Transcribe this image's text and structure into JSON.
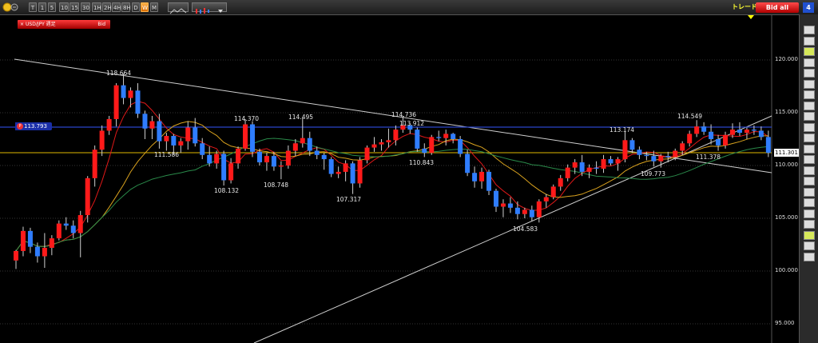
{
  "toolbar": {
    "timeframes": [
      "T",
      "1",
      "5",
      "10",
      "15",
      "30",
      "1H",
      "2H",
      "4H",
      "8H",
      "D",
      "W",
      "M"
    ],
    "active_timeframe": "W",
    "trend_link": "トレード",
    "bid_all": "Bid all",
    "pane_count": "4"
  },
  "symbol": {
    "name": "USD/JPY 週足",
    "side": "Bid"
  },
  "price_marker": "113.793",
  "current_price": "111.301",
  "y_axis": {
    "ticks": [
      "120.000",
      "115.000",
      "110.000",
      "105.000",
      "100.000",
      "95.000"
    ]
  },
  "annotations": [
    "118.664",
    "111.586",
    "114.370",
    "108.132",
    "108.748",
    "114.495",
    "107.317",
    "114.736",
    "113.912",
    "110.843",
    "104.583",
    "113.174",
    "109.773",
    "114.549",
    "111.378"
  ],
  "colors": {
    "up": "#ff1a1a",
    "down": "#2f7dff",
    "ma_fast": "#e01818",
    "ma_mid": "#d9a21e",
    "ma_slow": "#2a8a4a",
    "price_line": "#2b45c8",
    "current_line": "#e0b800"
  },
  "chart_data": {
    "type": "candlestick",
    "ylim": [
      93.5,
      122.5
    ],
    "candles": [
      [
        101.0,
        102.0,
        100.2,
        101.9
      ],
      [
        101.9,
        104.2,
        101.4,
        103.8
      ],
      [
        103.8,
        104.1,
        101.7,
        102.3
      ],
      [
        102.3,
        102.7,
        100.8,
        101.4
      ],
      [
        101.4,
        103.6,
        100.3,
        102.2
      ],
      [
        102.2,
        103.4,
        101.5,
        103.1
      ],
      [
        103.1,
        104.8,
        102.9,
        104.5
      ],
      [
        104.5,
        105.1,
        103.9,
        104.3
      ],
      [
        104.3,
        104.8,
        103.1,
        103.6
      ],
      [
        103.6,
        105.7,
        101.3,
        105.3
      ],
      [
        105.3,
        109.0,
        104.6,
        108.8
      ],
      [
        108.8,
        111.9,
        108.0,
        111.5
      ],
      [
        111.5,
        113.8,
        110.9,
        113.3
      ],
      [
        113.3,
        114.7,
        112.9,
        114.4
      ],
      [
        114.4,
        117.8,
        113.7,
        117.6
      ],
      [
        117.6,
        118.7,
        115.8,
        116.4
      ],
      [
        116.4,
        117.4,
        115.5,
        117.1
      ],
      [
        117.1,
        117.8,
        114.5,
        114.9
      ],
      [
        114.9,
        115.2,
        112.5,
        113.5
      ],
      [
        113.5,
        114.7,
        112.5,
        114.2
      ],
      [
        114.2,
        114.9,
        111.6,
        112.3
      ],
      [
        112.3,
        113.1,
        111.4,
        112.8
      ],
      [
        112.8,
        113.0,
        111.0,
        111.9
      ],
      [
        111.9,
        112.6,
        111.2,
        112.3
      ],
      [
        112.3,
        114.2,
        111.5,
        113.6
      ],
      [
        113.6,
        114.5,
        111.8,
        112.1
      ],
      [
        112.1,
        112.6,
        110.6,
        111.0
      ],
      [
        111.0,
        111.8,
        109.9,
        110.2
      ],
      [
        110.2,
        111.4,
        109.7,
        111.1
      ],
      [
        111.1,
        111.4,
        108.1,
        108.6
      ],
      [
        108.6,
        110.7,
        108.3,
        110.2
      ],
      [
        110.2,
        111.8,
        109.7,
        111.6
      ],
      [
        111.6,
        114.4,
        111.4,
        113.9
      ],
      [
        113.9,
        114.2,
        110.8,
        111.3
      ],
      [
        111.3,
        111.6,
        110.0,
        110.3
      ],
      [
        110.3,
        111.2,
        109.5,
        110.9
      ],
      [
        110.9,
        111.3,
        109.5,
        109.9
      ],
      [
        109.9,
        110.4,
        108.7,
        110.0
      ],
      [
        110.0,
        111.9,
        109.7,
        111.4
      ],
      [
        111.4,
        112.5,
        110.9,
        112.1
      ],
      [
        112.1,
        114.5,
        111.7,
        112.6
      ],
      [
        112.6,
        113.2,
        110.9,
        111.4
      ],
      [
        111.4,
        111.8,
        110.6,
        111.0
      ],
      [
        111.0,
        111.2,
        109.6,
        110.6
      ],
      [
        110.6,
        110.8,
        108.9,
        109.2
      ],
      [
        109.2,
        109.9,
        108.8,
        109.4
      ],
      [
        109.4,
        110.5,
        108.5,
        110.2
      ],
      [
        110.2,
        110.4,
        107.3,
        108.3
      ],
      [
        108.3,
        110.8,
        107.9,
        110.5
      ],
      [
        110.5,
        111.9,
        110.2,
        111.7
      ],
      [
        111.7,
        112.7,
        111.3,
        112.0
      ],
      [
        112.0,
        112.5,
        111.4,
        112.2
      ],
      [
        112.2,
        113.5,
        111.7,
        112.4
      ],
      [
        112.4,
        113.8,
        111.9,
        113.4
      ],
      [
        113.4,
        114.7,
        113.1,
        113.8
      ],
      [
        113.8,
        114.0,
        113.0,
        113.4
      ],
      [
        113.4,
        113.6,
        111.3,
        111.6
      ],
      [
        111.6,
        112.1,
        110.8,
        111.2
      ],
      [
        111.2,
        112.9,
        111.0,
        112.7
      ],
      [
        112.7,
        113.3,
        112.3,
        112.6
      ],
      [
        112.6,
        113.4,
        111.9,
        113.0
      ],
      [
        113.0,
        113.1,
        112.1,
        112.5
      ],
      [
        112.5,
        112.8,
        110.8,
        111.1
      ],
      [
        111.1,
        111.5,
        109.0,
        109.3
      ],
      [
        109.3,
        109.9,
        107.9,
        108.5
      ],
      [
        108.5,
        109.8,
        107.8,
        109.4
      ],
      [
        109.4,
        109.6,
        107.2,
        107.6
      ],
      [
        107.6,
        107.8,
        105.6,
        106.1
      ],
      [
        106.1,
        106.8,
        105.1,
        106.4
      ],
      [
        106.4,
        107.0,
        105.5,
        106.0
      ],
      [
        106.0,
        106.6,
        104.9,
        105.4
      ],
      [
        105.4,
        106.0,
        105.0,
        105.8
      ],
      [
        105.8,
        106.2,
        104.7,
        105.1
      ],
      [
        105.1,
        106.8,
        104.6,
        106.6
      ],
      [
        106.6,
        107.3,
        106.0,
        107.0
      ],
      [
        107.0,
        108.2,
        106.8,
        108.0
      ],
      [
        108.0,
        109.1,
        107.6,
        108.8
      ],
      [
        108.8,
        110.1,
        108.5,
        109.8
      ],
      [
        109.8,
        110.6,
        109.2,
        110.3
      ],
      [
        110.3,
        111.0,
        109.0,
        109.4
      ],
      [
        109.4,
        110.1,
        108.8,
        109.8
      ],
      [
        109.8,
        110.4,
        109.2,
        109.7
      ],
      [
        109.7,
        111.0,
        109.3,
        110.6
      ],
      [
        110.6,
        110.9,
        110.0,
        110.2
      ],
      [
        110.2,
        110.8,
        109.5,
        110.6
      ],
      [
        110.6,
        113.2,
        110.3,
        112.4
      ],
      [
        112.4,
        112.6,
        111.2,
        111.5
      ],
      [
        111.5,
        111.8,
        110.6,
        111.0
      ],
      [
        111.0,
        111.3,
        110.5,
        110.9
      ],
      [
        110.9,
        111.4,
        109.9,
        110.4
      ],
      [
        110.4,
        111.1,
        109.8,
        110.9
      ],
      [
        110.9,
        111.3,
        110.3,
        110.8
      ],
      [
        110.8,
        111.6,
        110.5,
        111.4
      ],
      [
        111.4,
        112.3,
        111.0,
        112.1
      ],
      [
        112.1,
        113.3,
        111.8,
        113.0
      ],
      [
        113.0,
        114.3,
        112.7,
        113.7
      ],
      [
        113.7,
        114.1,
        112.9,
        113.2
      ],
      [
        113.2,
        113.9,
        112.0,
        112.5
      ],
      [
        112.5,
        112.9,
        111.4,
        111.9
      ],
      [
        111.9,
        113.2,
        111.6,
        112.9
      ],
      [
        112.9,
        114.0,
        112.6,
        113.4
      ],
      [
        113.4,
        114.1,
        112.8,
        113.1
      ],
      [
        113.1,
        113.6,
        112.5,
        113.4
      ],
      [
        113.4,
        113.8,
        112.9,
        113.3
      ],
      [
        113.3,
        113.7,
        112.4,
        112.7
      ],
      [
        112.7,
        113.3,
        110.8,
        111.2
      ]
    ]
  }
}
